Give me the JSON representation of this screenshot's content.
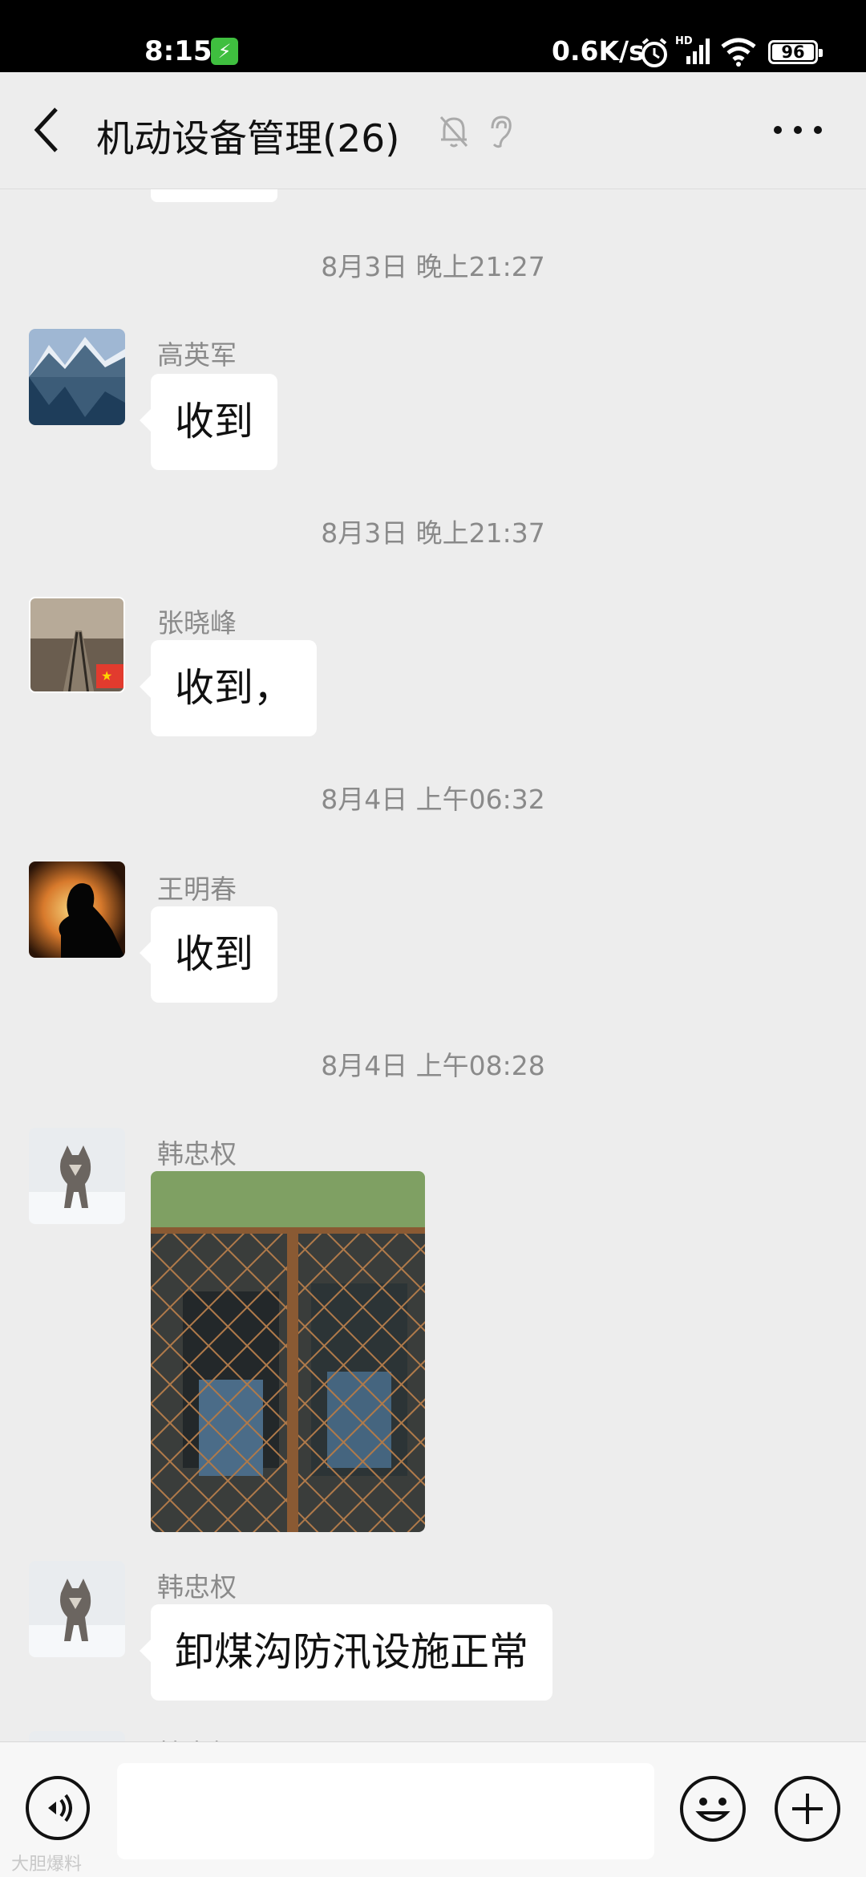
{
  "status_bar": {
    "time": "8:15",
    "network_speed": "0.6K/s",
    "battery": "96",
    "network_type": "HD"
  },
  "header": {
    "title": "机动设备管理(26)"
  },
  "messages": [
    {
      "timestamp": "8月3日 晚上21:27",
      "sender": "高英军",
      "text": "收到"
    },
    {
      "timestamp": "8月3日 晚上21:37",
      "sender": "张晓峰",
      "text": "收到，"
    },
    {
      "timestamp": "8月4日 上午06:32",
      "sender": "王明春",
      "text": "收到"
    },
    {
      "timestamp": "8月4日 上午08:28",
      "sender": "韩忠权",
      "type": "image"
    },
    {
      "sender": "韩忠权",
      "text": "卸煤沟防汛设施正常"
    },
    {
      "sender": "韩忠权"
    }
  ],
  "watermark": "大胆爆料",
  "colors": {
    "background": "#ededed",
    "bubble": "#ffffff",
    "meta_text": "#8a8a8a",
    "status_bar": "#000000"
  }
}
